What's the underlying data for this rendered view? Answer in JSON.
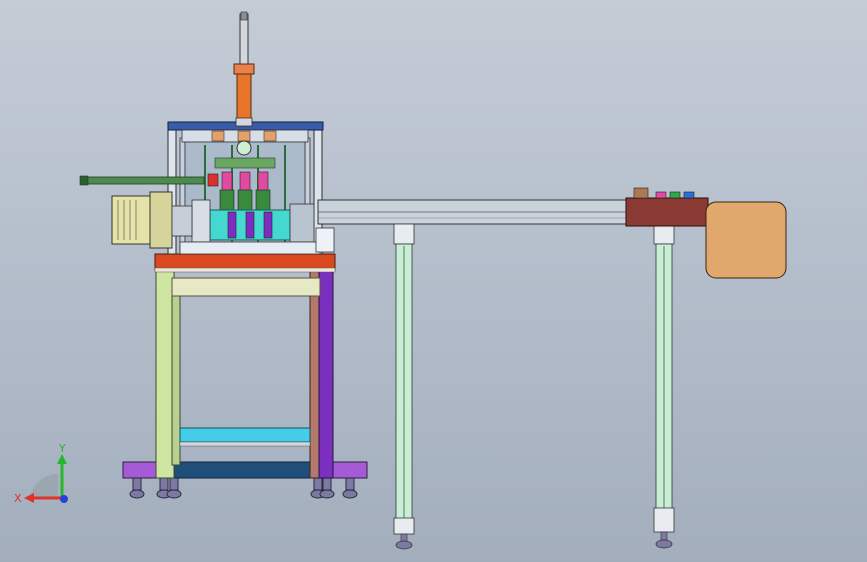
{
  "viewport": {
    "background_top": "#c4ccd6",
    "background_bottom": "#a3aebd",
    "view_mode": "front-orthographic"
  },
  "triad": {
    "x_label": "X",
    "y_label": "Y",
    "x_color": "#e0322c",
    "y_color": "#25b82e",
    "z_color": "#2a3fd8"
  },
  "colors": {
    "frame_table_top": "#d9481e",
    "frame_left_leg": "#cfe6a3",
    "frame_right_leg": "#7a2fbf",
    "frame_right_post": "#b37a6b",
    "foot_bar": "#a55ad6",
    "lower_crossbar": "#1f4e7a",
    "upper_crossbar": "#44cce8",
    "top_plate": "#3a5ba8",
    "cylinder": "#e7762a",
    "rail": "#c9d3dc",
    "support_posts": "#c8efd6",
    "control_box": "#8a3a32",
    "tray": "#e0a86c",
    "motor": "#e6e3a8"
  }
}
